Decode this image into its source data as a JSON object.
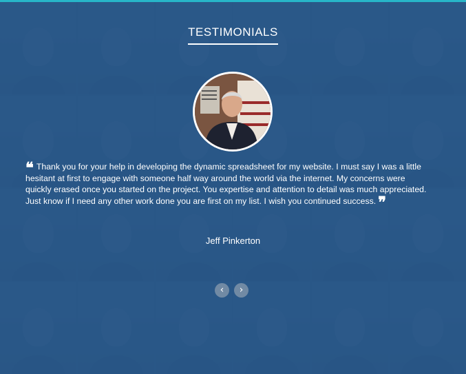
{
  "section": {
    "title": "TESTIMONIALS"
  },
  "testimonial": {
    "quote": "Thank you for your help in developing the dynamic spreadsheet for my website.  I must say I was a little hesitant at first to engage with someone half way around the world via the internet.  My concerns were quickly erased once you started on the project. You expertise and attention to detail was much appreciated.  Just know if I need any other work done you are first on my list. I wish you continued success.",
    "open_mark": "❝",
    "close_mark": "❞",
    "author": "Jeff Pinkerton"
  },
  "carousel": {
    "prev_icon": "‹",
    "next_icon": "›"
  },
  "colors": {
    "background": "#2c5a89",
    "accent_bar": "#27b6c9",
    "text": "#ffffff"
  }
}
